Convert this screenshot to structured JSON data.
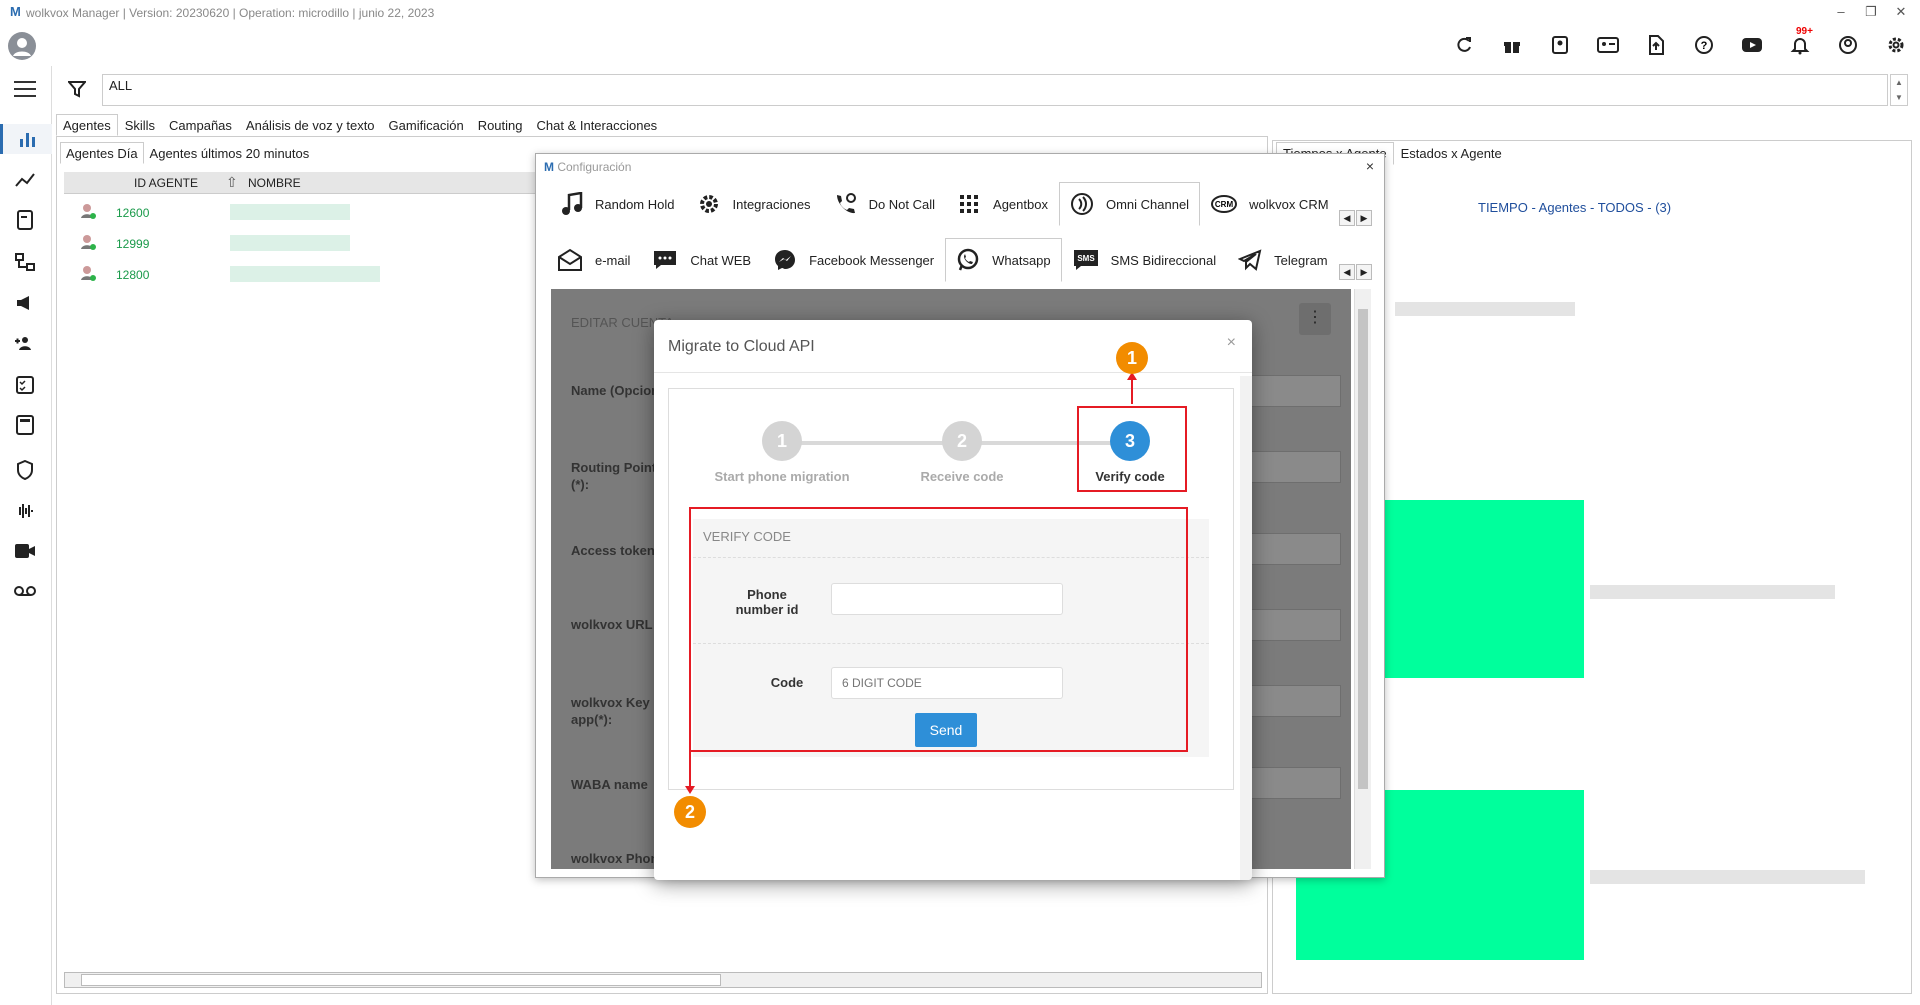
{
  "titlebar": {
    "logo": "M",
    "title": "wolkvox Manager  | Version: 20230620 |  Operation: microdillo  | junio 22, 2023",
    "min": "–",
    "restore": "❐",
    "close": "✕"
  },
  "topicons": [
    "refresh-icon",
    "gift-icon",
    "contacts-book-icon",
    "id-card-icon",
    "file-upload-icon",
    "help-icon",
    "youtube-icon",
    "bell-icon",
    "user-circle-icon",
    "settings-icon"
  ],
  "notifications": {
    "badge": "99+"
  },
  "filter": {
    "value": "ALL"
  },
  "main_tabs": [
    "Agentes",
    "Skills",
    "Campañas",
    "Análisis de voz y texto",
    "Gamificación",
    "Routing",
    "Chat & Interacciones"
  ],
  "sub_tabs": [
    "Agentes Día",
    "Agentes últimos 20 minutos"
  ],
  "grid": {
    "columns": [
      "ID AGENTE",
      "NOMBRE"
    ],
    "rows": [
      {
        "id": "12600"
      },
      {
        "id": "12999"
      },
      {
        "id": "12800"
      }
    ]
  },
  "right_tabs": [
    "Tiempos x Agente",
    "Estados x Agente"
  ],
  "right_title": "TIEMPO - Agentes - TODOS -  (3)",
  "config": {
    "title": "Configuración",
    "close": "×",
    "tabs_row1": [
      "Random Hold",
      "Integraciones",
      "Do Not Call",
      "Agentbox",
      "Omni Channel",
      "wolkvox CRM"
    ],
    "tabs_row2": [
      "e-mail",
      "Chat WEB",
      "Facebook Messenger",
      "Whatsapp",
      "SMS Bidireccional",
      "Telegram"
    ],
    "form": {
      "header": "EDITAR CUENTA",
      "labels": [
        "Name (Opcional)",
        "Routing Point (*):",
        "Access token",
        "wolkvox URL",
        "wolkvox Key app(*):",
        "WABA name",
        "wolkvox Phone"
      ]
    }
  },
  "modal": {
    "title": "Migrate to Cloud API",
    "close": "×",
    "steps": [
      {
        "num": "1",
        "label": "Start phone migration"
      },
      {
        "num": "2",
        "label": "Receive code"
      },
      {
        "num": "3",
        "label": "Verify code"
      }
    ],
    "section_title": "VERIFY CODE",
    "phone_label": "Phone number id",
    "phone_value": "",
    "code_label": "Code",
    "code_placeholder": "6 DIGIT CODE",
    "send_label": "Send"
  },
  "annotations": [
    "1",
    "2"
  ],
  "colors": {
    "accent": "#2e8fd8",
    "annotation": "#f28c00",
    "highlight": "#e51b24",
    "green": "#00ff9c"
  }
}
